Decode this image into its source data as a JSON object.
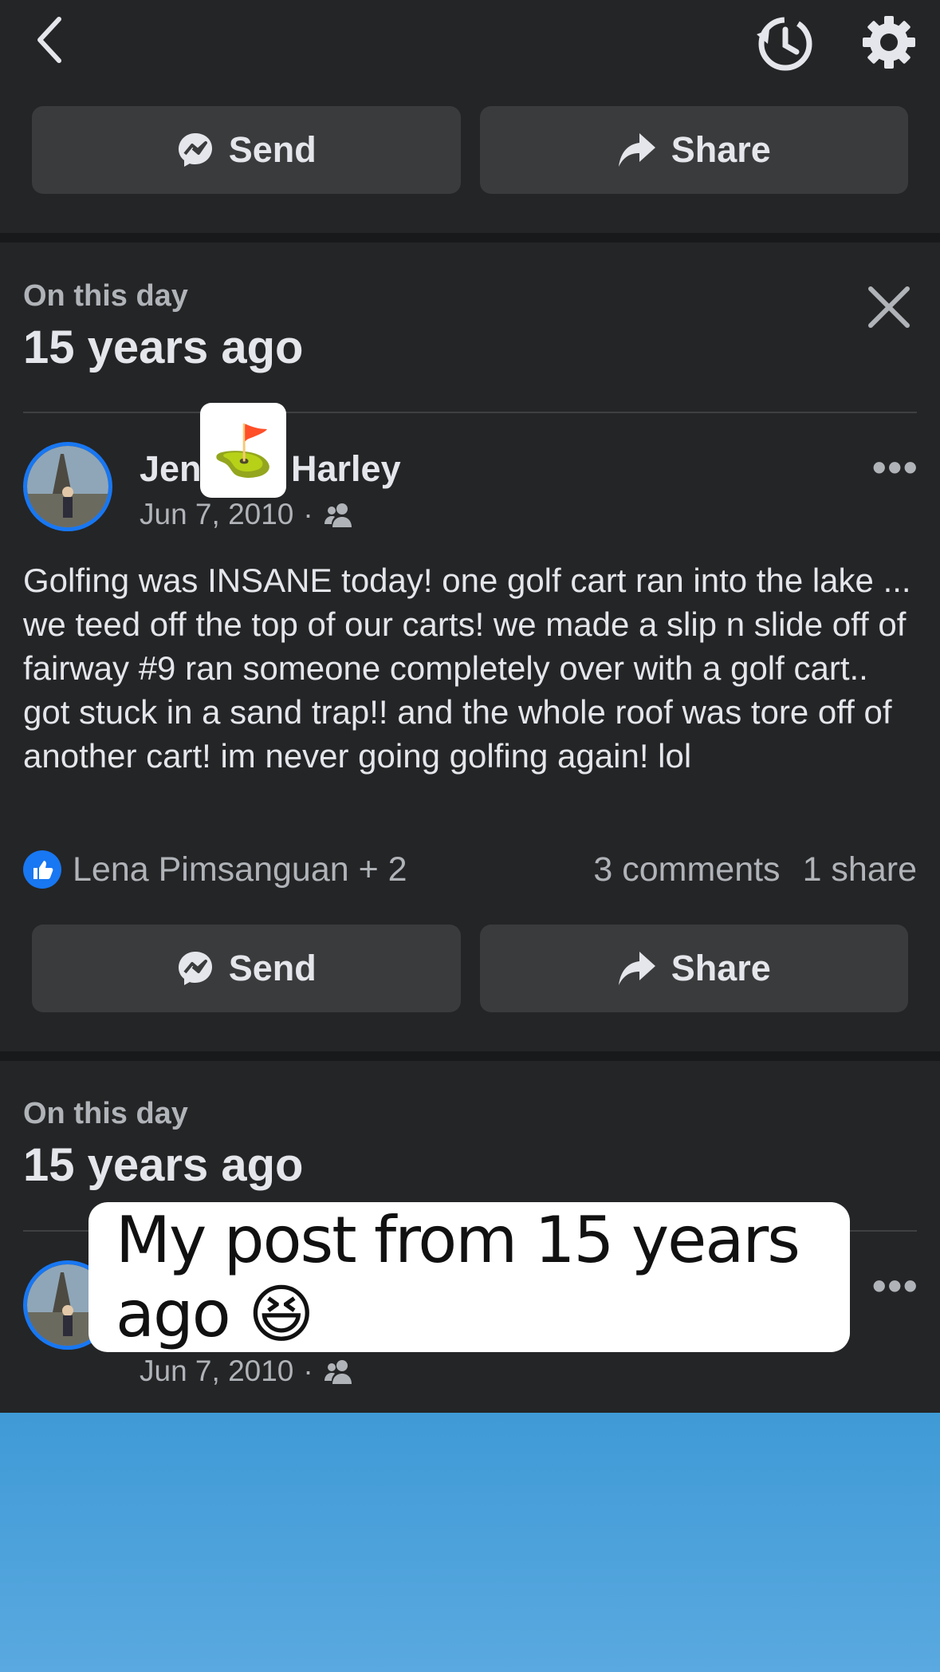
{
  "topbar": {
    "back_icon": "chevron-left-icon",
    "history_icon": "history-icon",
    "settings_icon": "gear-icon"
  },
  "actions_top": {
    "send_label": "Send",
    "share_label": "Share"
  },
  "memory1": {
    "label": "On this day",
    "title": "15 years ago",
    "author_first": "Jen",
    "author_last": "Harley",
    "sticker_emoji": "⛳",
    "date": "Jun 7, 2010",
    "separator": "·",
    "audience_icon": "friends-icon",
    "body": "Golfing was INSANE today! one golf cart ran into the lake ... we teed off the top of our carts! we made a slip n slide off of fairway #9 ran someone completely over with a golf cart.. got stuck in a sand trap!! and the whole roof was tore off of another cart! im never going golfing again! lol",
    "reactors": "Lena Pimsanguan + 2",
    "comments": "3 comments",
    "shares": "1 share",
    "send_label": "Send",
    "share_label": "Share",
    "more": "•••"
  },
  "memory2": {
    "label": "On this day",
    "title": "15 years ago",
    "date": "Jun 7, 2010",
    "separator": "·",
    "more": "•••"
  },
  "caption": {
    "text": "My post from 15 years ago 😆"
  },
  "colors": {
    "accent": "#1877f2",
    "background": "#242526",
    "button": "#3a3b3c"
  }
}
